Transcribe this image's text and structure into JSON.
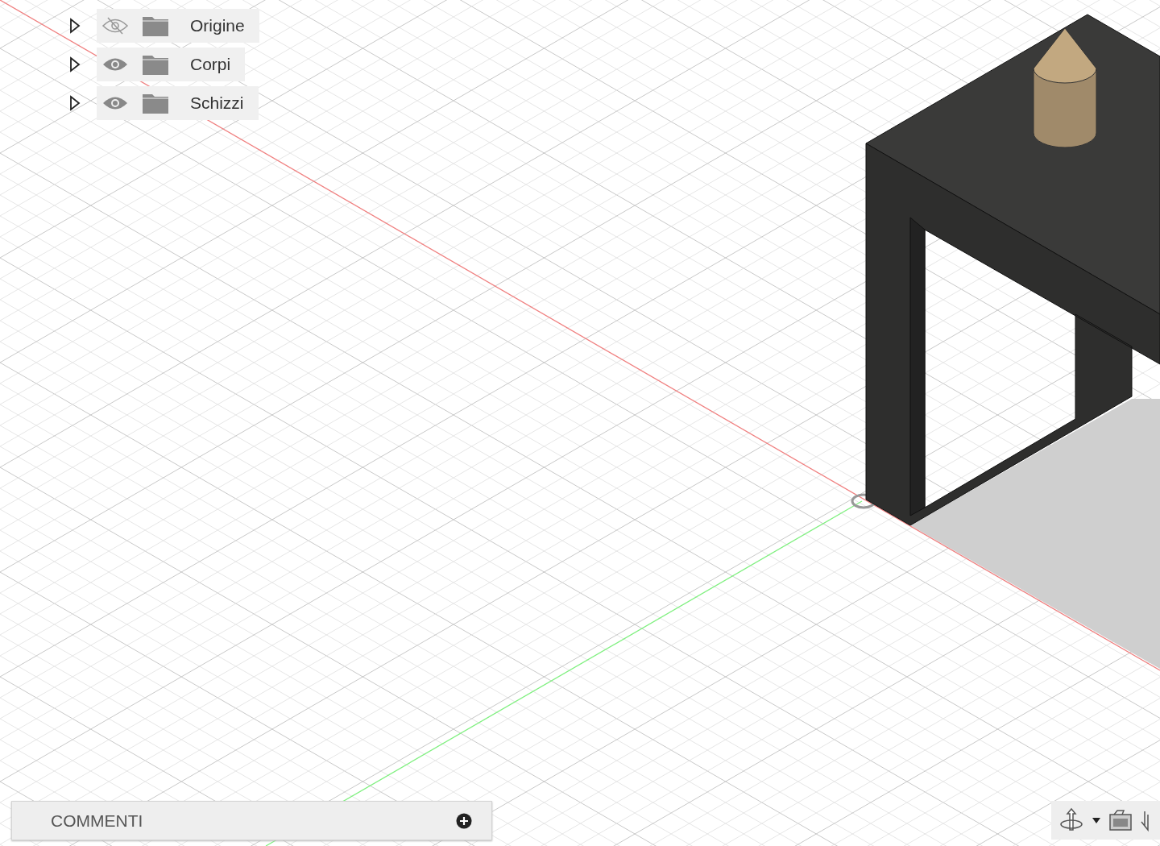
{
  "browser": {
    "items": [
      {
        "label": "Origine",
        "visible": false
      },
      {
        "label": "Corpi",
        "visible": true
      },
      {
        "label": "Schizzi",
        "visible": true
      }
    ]
  },
  "comments": {
    "title": "COMMENTI"
  }
}
